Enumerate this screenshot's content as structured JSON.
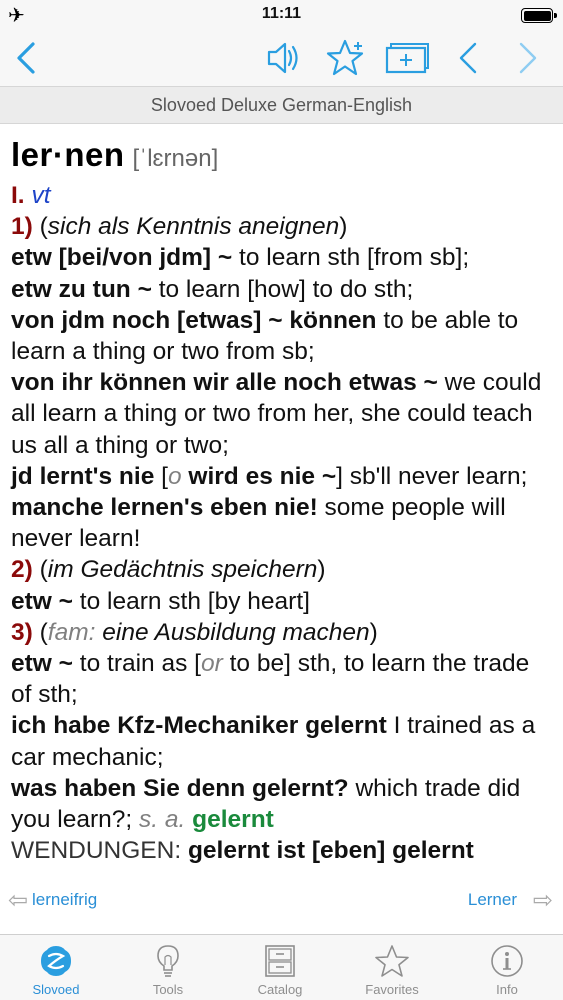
{
  "status_bar": {
    "time": "11:11",
    "airplane_glyph": "✈"
  },
  "toolbar": {
    "icons": [
      "back-chevron-icon",
      "speaker-icon",
      "star-add-icon",
      "add-card-icon",
      "prev-chevron-icon",
      "next-chevron-icon"
    ],
    "accent_color": "#2a9ee0"
  },
  "dictionary_title": "Slovoed Deluxe German-English",
  "entry": {
    "headword": "ler·nen",
    "transcription": "[ˈlɛrnən]",
    "roman_num": "I.",
    "pos": "vt",
    "s1_num": "1)",
    "s1_gloss_open": "(",
    "s1_gloss": "sich als Kenntnis aneignen",
    "s1_gloss_close": ")",
    "ex1_de": "etw [bei/von jdm] ~",
    "ex1_en": "to learn sth [from sb];",
    "ex2_de": "etw zu tun ~",
    "ex2_en": "to learn [how] to do sth;",
    "ex3_de": "von jdm noch [etwas] ~ können",
    "ex3_en": "to be able to learn a thing or two from sb;",
    "ex4_de": "von ihr können wir alle noch etwas ~",
    "ex4_en": "we could all learn a thing or two from her, she could teach us all a thing or two;",
    "ex5_de": "jd lernt's nie",
    "ex5_bracket_open": "[",
    "ex5_or": "o",
    "ex5_alt": "wird es nie ~",
    "ex5_bracket_close": "]",
    "ex5_en": "sb'll never learn;",
    "ex6_de": "manche lernen's eben nie!",
    "ex6_en": "some people will never learn!",
    "s2_num": "2)",
    "s2_gloss_open": "(",
    "s2_gloss": "im Gedächtnis speichern",
    "s2_gloss_close": ")",
    "ex7_de": "etw ~",
    "ex7_en": "to learn sth [by heart]",
    "s3_num": "3)",
    "s3_gloss_open": "(",
    "s3_label": "fam:",
    "s3_gloss": "eine Ausbildung machen",
    "s3_gloss_close": ")",
    "ex8_de": "etw ~",
    "ex8_en1": "to train as [",
    "ex8_or": "or",
    "ex8_en2": "to be] sth, to learn the trade of sth;",
    "ex9_de": "ich habe Kfz-Mechaniker gelernt",
    "ex9_en": "I trained as a car mechanic;",
    "ex10_de": "was haben Sie denn gelernt?",
    "ex10_en": "which trade did you learn?;",
    "see_also": "s. a.",
    "see_also_link": "gelernt",
    "idioms_label": "WENDUNGEN:",
    "idiom1_de": "gelernt ist [eben] gelernt"
  },
  "neighbors": {
    "prev": "lerneifrig",
    "next": "Lerner"
  },
  "tabs": [
    {
      "label": "Slovoed",
      "icon": "slovoed-logo-icon",
      "active": true
    },
    {
      "label": "Tools",
      "icon": "lightbulb-icon",
      "active": false
    },
    {
      "label": "Catalog",
      "icon": "cabinet-icon",
      "active": false
    },
    {
      "label": "Favorites",
      "icon": "star-icon",
      "active": false
    },
    {
      "label": "Info",
      "icon": "info-icon",
      "active": false
    }
  ],
  "colors": {
    "accent": "#2a9ee0",
    "sense_number": "#8b0a0a",
    "part_of_speech": "#1e44c8",
    "cross_reference": "#1a8a3c"
  }
}
